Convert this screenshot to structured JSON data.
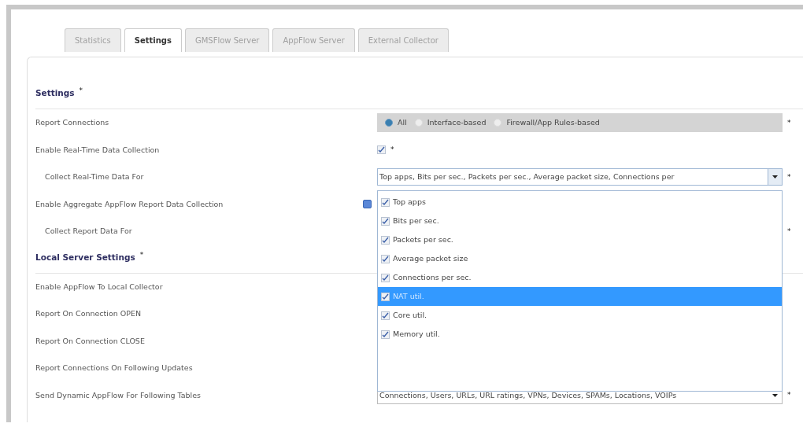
{
  "tabs": [
    {
      "label": "Statistics",
      "selected": false
    },
    {
      "label": "Settings",
      "selected": true
    },
    {
      "label": "GMSFlow Server",
      "selected": false
    },
    {
      "label": "AppFlow Server",
      "selected": false
    },
    {
      "label": "External Collector",
      "selected": false
    }
  ],
  "sections": [
    {
      "title": "Settings",
      "marker": "*",
      "rows": [
        {
          "label": "Report Connections",
          "kind": "radio",
          "marker": "*",
          "options": [
            {
              "label": "All",
              "selected": true
            },
            {
              "label": "Interface-based",
              "selected": false
            },
            {
              "label": "Firewall/App Rules-based",
              "selected": false
            }
          ]
        },
        {
          "label": "Enable Real-Time Data Collection",
          "kind": "checkbox",
          "checked": true,
          "marker": "*",
          "children": [
            {
              "label": "Collect Real-Time Data For",
              "kind": "select",
              "value": "Top apps, Bits per sec., Packets per sec., Average packet size, Connections per",
              "marker": "*",
              "expanded": true,
              "options": [
                {
                  "label": "Top apps",
                  "checked": true,
                  "selected": false
                },
                {
                  "label": "Bits per sec.",
                  "checked": true,
                  "selected": false
                },
                {
                  "label": "Packets per sec.",
                  "checked": true,
                  "selected": false
                },
                {
                  "label": "Average packet size",
                  "checked": true,
                  "selected": false
                },
                {
                  "label": "Connections per sec.",
                  "checked": true,
                  "selected": false
                },
                {
                  "label": "NAT util.",
                  "checked": true,
                  "selected": true
                },
                {
                  "label": "Core util.",
                  "checked": true,
                  "selected": false
                },
                {
                  "label": "Memory util.",
                  "checked": true,
                  "selected": false
                }
              ]
            }
          ]
        },
        {
          "label": "Enable Aggregate AppFlow Report Data Collection",
          "kind": "expander",
          "children": [
            {
              "label": "Collect Report Data For",
              "kind": "hidden",
              "marker": "*"
            }
          ]
        }
      ]
    },
    {
      "title": "Local Server Settings",
      "marker": "*",
      "rows": [
        {
          "label": "Enable AppFlow To Local Collector",
          "kind": "hidden"
        },
        {
          "label": "Report On Connection OPEN",
          "kind": "hidden"
        },
        {
          "label": "Report On Connection CLOSE",
          "kind": "hidden"
        },
        {
          "label": "Report Connections On Following Updates",
          "kind": "hidden"
        },
        {
          "label": "Send Dynamic AppFlow For Following Tables",
          "kind": "select",
          "value": "Connections, Users, URLs, URL ratings, VPNs, Devices, SPAMs, Locations, VOIPs",
          "marker": "*",
          "expanded": false
        }
      ]
    }
  ]
}
